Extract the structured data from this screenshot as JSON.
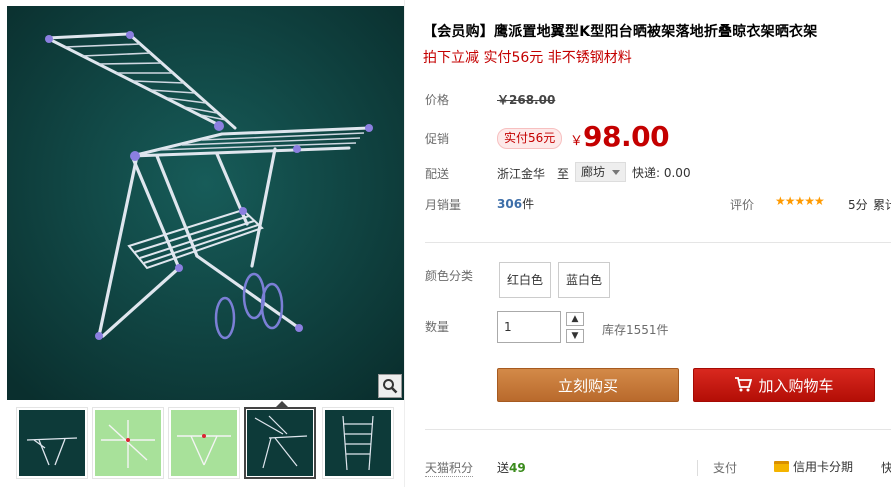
{
  "product": {
    "title": "【会员购】鹰派置地翼型K型阳台晒被架落地折叠晾衣架晒衣架",
    "subtitle": "拍下立减 实付56元 非不锈钢材料"
  },
  "price": {
    "label": "价格",
    "original": "￥268.00",
    "promo_label": "促销",
    "promo_badge": "实付56元",
    "currency": "￥",
    "current": "98.00"
  },
  "shipping": {
    "label": "配送",
    "from": "浙江金华",
    "to_word": "至",
    "city": "廊坊",
    "fee": "快递: 0.00"
  },
  "sales": {
    "label": "月销量",
    "count": "306",
    "unit": "件",
    "rating_label": "评价",
    "stars": "★★★★★",
    "rating_score": 5,
    "score_text": "5分",
    "cumulative_label": "累计"
  },
  "color": {
    "label": "颜色分类",
    "options": [
      "红白色",
      "蓝白色"
    ]
  },
  "quantity": {
    "label": "数量",
    "value": "1",
    "stock": "库存1551件"
  },
  "buttons": {
    "buy": "立刻购买",
    "cart": "加入购物车"
  },
  "footer": {
    "points_label": "天猫积分",
    "points_prefix": "送",
    "points_value": "49",
    "pay_label": "支付",
    "credit": "信用卡分期",
    "more": "快"
  },
  "colors": {
    "accent_red": "#c40000",
    "image_bg": "#0d3a39",
    "buy_button": "#c27532",
    "cart_button": "#c4170f"
  },
  "gallery": {
    "thumbnails": [
      {
        "name": "thumb-1",
        "bg": "#0d3a39"
      },
      {
        "name": "thumb-2",
        "bg": "#a8e19a"
      },
      {
        "name": "thumb-3",
        "bg": "#a8e19a"
      },
      {
        "name": "thumb-4",
        "bg": "#0d3a39"
      },
      {
        "name": "thumb-5",
        "bg": "#0d3a39"
      }
    ],
    "active_index": 3
  }
}
